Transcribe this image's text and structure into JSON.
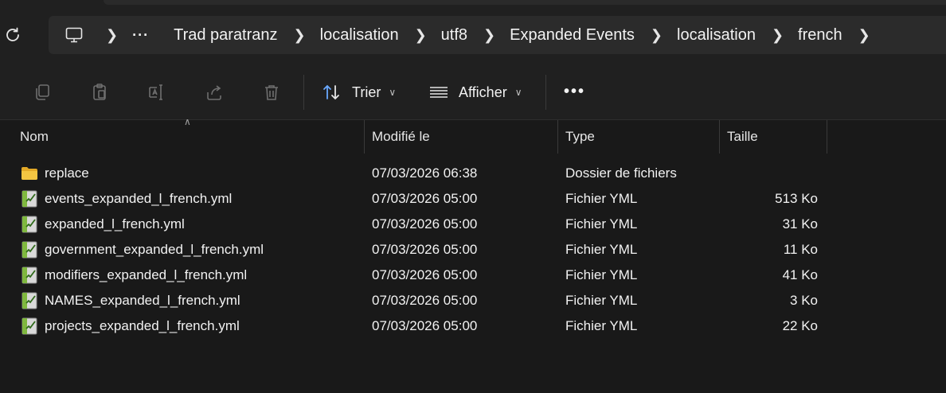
{
  "breadcrumb": {
    "overflow_label": "···",
    "items": [
      "Trad paratranz",
      "localisation",
      "utf8",
      "Expanded Events",
      "localisation",
      "french"
    ]
  },
  "toolbar": {
    "sort_label": "Trier",
    "view_label": "Afficher",
    "more_label": "•••"
  },
  "columns": {
    "name": "Nom",
    "modified": "Modifié le",
    "type": "Type",
    "size": "Taille"
  },
  "files": [
    {
      "name": "replace",
      "modified": "07/03/2026 06:38",
      "type": "Dossier de fichiers",
      "size": "",
      "icon": "folder-icon"
    },
    {
      "name": "events_expanded_l_french.yml",
      "modified": "07/03/2026 05:00",
      "type": "Fichier YML",
      "size": "513 Ko",
      "icon": "yml-file-icon"
    },
    {
      "name": "expanded_l_french.yml",
      "modified": "07/03/2026 05:00",
      "type": "Fichier YML",
      "size": "31 Ko",
      "icon": "yml-file-icon"
    },
    {
      "name": "government_expanded_l_french.yml",
      "modified": "07/03/2026 05:00",
      "type": "Fichier YML",
      "size": "11 Ko",
      "icon": "yml-file-icon"
    },
    {
      "name": "modifiers_expanded_l_french.yml",
      "modified": "07/03/2026 05:00",
      "type": "Fichier YML",
      "size": "41 Ko",
      "icon": "yml-file-icon"
    },
    {
      "name": "NAMES_expanded_l_french.yml",
      "modified": "07/03/2026 05:00",
      "type": "Fichier YML",
      "size": "3 Ko",
      "icon": "yml-file-icon"
    },
    {
      "name": "projects_expanded_l_french.yml",
      "modified": "07/03/2026 05:00",
      "type": "Fichier YML",
      "size": "22 Ko",
      "icon": "yml-file-icon"
    }
  ],
  "colors": {
    "background": "#191919",
    "toolbar": "#202020",
    "address_bar": "#2b2b2b",
    "folder": "#f4c542",
    "sort_icon": "#6aa9ff"
  }
}
